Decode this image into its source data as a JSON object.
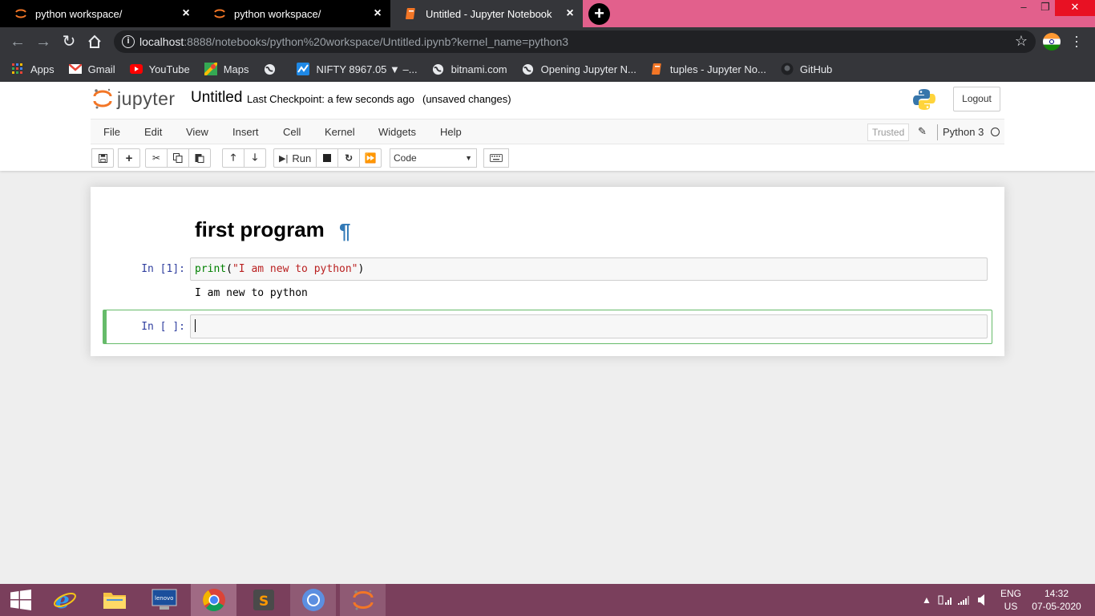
{
  "browser": {
    "tabs": [
      {
        "title": "python workspace/",
        "active": false
      },
      {
        "title": "python workspace/",
        "active": false
      },
      {
        "title": "Untitled - Jupyter Notebook",
        "active": true
      }
    ],
    "new_tab": "+",
    "url_host": "localhost",
    "url_rest": ":8888/notebooks/python%20workspace/Untitled.ipynb?kernel_name=python3",
    "bookmarks": [
      {
        "label": "Apps",
        "icon": "apps-grid-icon"
      },
      {
        "label": "Gmail",
        "icon": "gmail-icon"
      },
      {
        "label": "YouTube",
        "icon": "youtube-icon"
      },
      {
        "label": "Maps",
        "icon": "maps-icon"
      },
      {
        "label": "",
        "icon": "globe-icon"
      },
      {
        "label": "NIFTY 8967.05 ▼ –...",
        "icon": "nifty-icon"
      },
      {
        "label": "bitnami.com",
        "icon": "globe-icon"
      },
      {
        "label": "Opening Jupyter N...",
        "icon": "globe-icon"
      },
      {
        "label": "tuples - Jupyter No...",
        "icon": "notebook-icon"
      },
      {
        "label": "GitHub",
        "icon": "github-icon"
      }
    ]
  },
  "jupyter": {
    "logo_text": "jupyter",
    "notebook_name": "Untitled",
    "checkpoint": "Last Checkpoint: a few seconds ago",
    "unsaved": "(unsaved changes)",
    "logout": "Logout",
    "menu": [
      "File",
      "Edit",
      "View",
      "Insert",
      "Cell",
      "Kernel",
      "Widgets",
      "Help"
    ],
    "trusted": "Trusted",
    "kernel": "Python 3",
    "run_label": "Run",
    "cell_type": "Code"
  },
  "notebook": {
    "heading": "first program",
    "pilcrow": "¶",
    "cell1_prompt": "In [1]:",
    "cell1_code_fn": "print",
    "cell1_code_open": "(",
    "cell1_code_str": "\"I am new to python\"",
    "cell1_code_close": ")",
    "cell1_output": "I am new to python",
    "cell2_prompt": "In [ ]:"
  },
  "taskbar": {
    "lang_top": "ENG",
    "lang_bottom": "US",
    "time": "14:32",
    "date": "07-05-2020"
  },
  "colors": {
    "tab_strip": "#e2608c",
    "chrome_dark": "#35363a",
    "jupyter_orange": "#f37626",
    "selected_cell_border": "#66bb6a",
    "prompt_blue": "#303f9f",
    "taskbar": "#7a3f5c"
  }
}
